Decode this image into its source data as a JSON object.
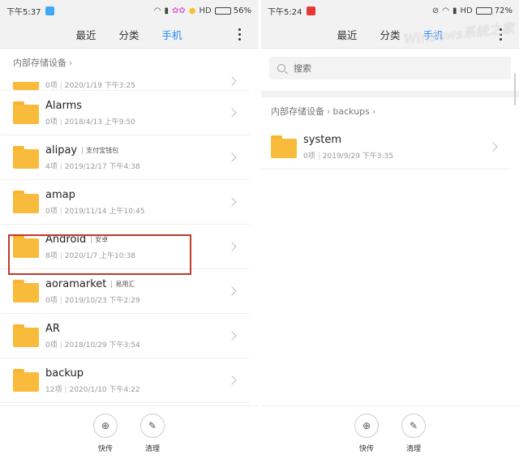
{
  "left": {
    "status": {
      "time": "下午5:37",
      "hd": "HD",
      "battery": "56%",
      "battery_level": 0.56
    },
    "tabs": [
      {
        "label": "最近",
        "active": false
      },
      {
        "label": "分类",
        "active": false
      },
      {
        "label": "手机",
        "active": true
      }
    ],
    "breadcrumb": [
      "内部存储设备"
    ],
    "partial_row": {
      "meta_count": "0项",
      "meta_date": "2020/1/19 下午3:25"
    },
    "folders": [
      {
        "name": "Alarms",
        "tag": "",
        "count": "0项",
        "date": "2018/4/13 上午9:50"
      },
      {
        "name": "alipay",
        "tag": "支付宝钱包",
        "count": "4项",
        "date": "2019/12/17 下午4:38"
      },
      {
        "name": "amap",
        "tag": "",
        "count": "0项",
        "date": "2019/11/14 上午10:45"
      },
      {
        "name": "Android",
        "tag": "安卓",
        "count": "8项",
        "date": "2020/1/7 上午10:38"
      },
      {
        "name": "aoramarket",
        "tag": "易用汇",
        "count": "0项",
        "date": "2019/10/23 下午2:29"
      },
      {
        "name": "AR",
        "tag": "",
        "count": "0项",
        "date": "2018/10/29 下午3:54"
      },
      {
        "name": "backup",
        "tag": "",
        "count": "12项",
        "date": "2020/1/10 下午4:22"
      }
    ],
    "bottom": {
      "send": "快传",
      "clean": "清理"
    }
  },
  "right": {
    "status": {
      "time": "下午5:24",
      "hd": "HD",
      "battery": "72%",
      "battery_level": 0.72
    },
    "tabs": [
      {
        "label": "最近",
        "active": false
      },
      {
        "label": "分类",
        "active": false
      },
      {
        "label": "手机",
        "active": true
      }
    ],
    "search": {
      "placeholder": "搜索"
    },
    "breadcrumb": [
      "内部存储设备",
      "backups"
    ],
    "folders": [
      {
        "name": "system",
        "tag": "",
        "count": "0项",
        "date": "2019/9/29 下午3:35"
      }
    ],
    "bottom": {
      "send": "快传",
      "clean": "清理"
    },
    "watermark": "Windows系统之家"
  },
  "colors": {
    "accent": "#1e88ff",
    "folder": "#f9bb3c",
    "highlight": "#c0392b"
  },
  "icons": [
    "wifi-icon",
    "signal-icon",
    "battery-icon",
    "more-vertical-icon",
    "folder-icon",
    "chevron-right-icon",
    "search-icon",
    "send-icon",
    "broom-icon"
  ]
}
